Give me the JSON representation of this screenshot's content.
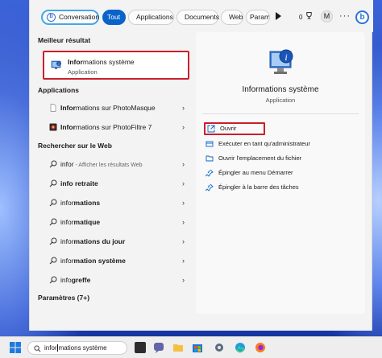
{
  "filters": {
    "conversation": "Conversation",
    "tout": "Tout",
    "applications": "Applications",
    "documents": "Documents",
    "web": "Web",
    "parametres": "Param"
  },
  "topbar": {
    "rewards_count": "0",
    "avatar_letter": "M",
    "more_label": "···",
    "bing_label": "b"
  },
  "left": {
    "best_title": "Meilleur résultat",
    "best": {
      "bold": "Infor",
      "rest": "mations système",
      "type": "Application"
    },
    "apps_title": "Applications",
    "apps": [
      {
        "bold": "Infor",
        "rest": "mations sur PhotoMasque"
      },
      {
        "bold": "Infor",
        "rest": "mations sur PhotoFiltre 7"
      }
    ],
    "web_title": "Rechercher sur le Web",
    "web": [
      {
        "bold": "",
        "rest": "infor",
        "hint": " - Afficher les résultats Web"
      },
      {
        "bold": "info retraite",
        "rest": "",
        "hint": ""
      },
      {
        "bold": "",
        "rest": "infor",
        "suffix": "mations",
        "hint": ""
      },
      {
        "bold": "",
        "rest": "infor",
        "suffix": "matique",
        "hint": ""
      },
      {
        "bold": "",
        "rest": "infor",
        "suffix": "mations du jour",
        "hint": ""
      },
      {
        "bold": "",
        "rest": "infor",
        "suffix": "mation système",
        "hint": ""
      },
      {
        "bold": "",
        "rest": "info",
        "suffix": "greffe",
        "hint": ""
      }
    ],
    "settings_title": "Paramètres (7+)"
  },
  "right": {
    "title": "Informations système",
    "subtitle": "Application",
    "actions": [
      "Ouvrir",
      "Exécuter en tant qu'administrateur",
      "Ouvrir l'emplacement du fichier",
      "Épingler au menu Démarrer",
      "Épingler à la barre des tâches"
    ]
  },
  "taskbar": {
    "search_typed": "infor",
    "search_rest": "mations système"
  },
  "colors": {
    "accent": "#0a63c9",
    "highlight_box": "#c9202b",
    "conversation_border": "#43a7e9"
  }
}
